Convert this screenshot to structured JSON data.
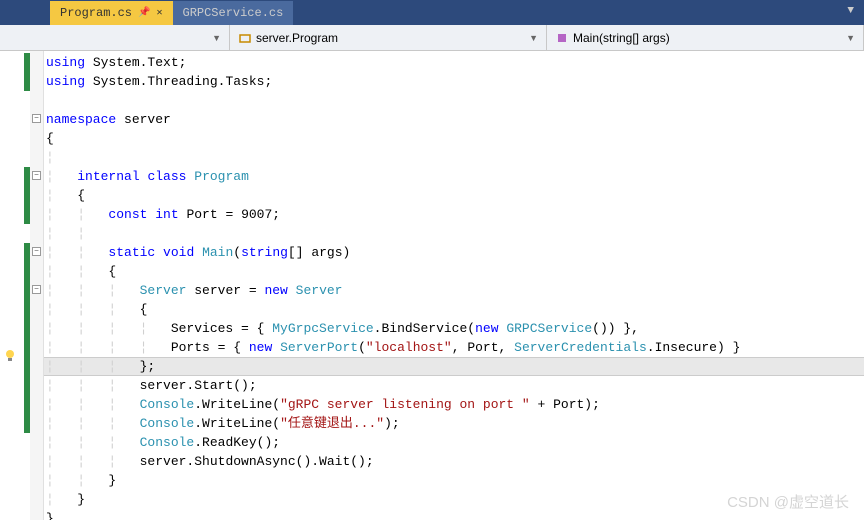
{
  "tabs": {
    "active": "Program.cs",
    "inactive": "GRPCService.cs"
  },
  "breadcrumb": {
    "seg1": "",
    "seg2": "server.Program",
    "seg3": "Main(string[] args)"
  },
  "code": {
    "l1_using": "using",
    "l1_rest": " System.Text;",
    "l2_using": "using",
    "l2_rest": " System.Threading.Tasks;",
    "l4_ns": "namespace",
    "l4_name": " server",
    "l5": "{",
    "l7_internal": "internal",
    "l7_class": "class",
    "l7_name": "Program",
    "l8": "{",
    "l9_const": "const",
    "l9_int": "int",
    "l9_rest": " Port = 9007;",
    "l11_static": "static",
    "l11_void": "void",
    "l11_main": "Main",
    "l11_string": "string",
    "l11_args": "[] args)",
    "l12": "{",
    "l13_server1": "Server",
    "l13_var": " server = ",
    "l13_new": "new",
    "l13_server2": "Server",
    "l14": "{",
    "l15_svc": "Services = { ",
    "l15_my": "MyGrpcService",
    "l15_bind": ".BindService(",
    "l15_new": "new",
    "l15_grpc": "GRPCService",
    "l15_end": "()) },",
    "l16_ports": "Ports = { ",
    "l16_new": "new",
    "l16_sp": "ServerPort",
    "l16_open": "(",
    "l16_str": "\"localhost\"",
    "l16_mid": ", Port, ",
    "l16_cred": "ServerCredentials",
    "l16_end": ".Insecure) }",
    "l17": "};",
    "l18": "server.Start();",
    "l19_con": "Console",
    "l19_wl": ".WriteLine(",
    "l19_str": "\"gRPC server listening on port \"",
    "l19_end": " + Port);",
    "l20_con": "Console",
    "l20_wl": ".WriteLine(",
    "l20_str": "\"任意键退出...\"",
    "l20_end": ");",
    "l21_con": "Console",
    "l21_rk": ".ReadKey();",
    "l22": "server.ShutdownAsync().Wait();",
    "l23": "}",
    "l24": "}",
    "l25": "}"
  },
  "watermark": "CSDN @虚空道长"
}
